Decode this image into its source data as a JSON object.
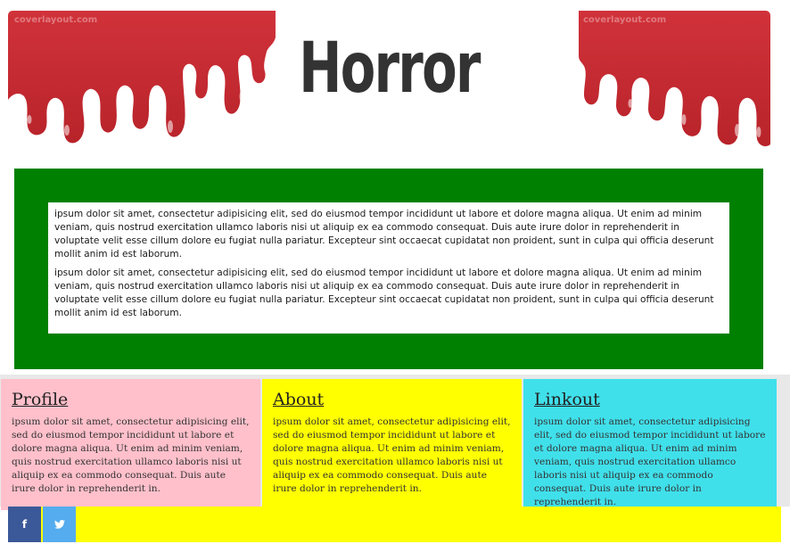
{
  "header": {
    "title": "Horror",
    "watermark": "coverlayout.com",
    "blood_color": "#c62a31"
  },
  "main": {
    "background": "#008000",
    "paragraphs": [
      "ipsum dolor sit amet, consectetur adipisicing elit, sed do eiusmod tempor incididunt ut labore et dolore magna aliqua. Ut enim ad minim veniam, quis nostrud exercitation ullamco laboris nisi ut aliquip ex ea commodo consequat. Duis aute irure dolor in reprehenderit in voluptate velit esse cillum dolore eu fugiat nulla pariatur. Excepteur sint occaecat cupidatat non proident, sunt in culpa qui officia deserunt mollit anim id est laborum.",
      "ipsum dolor sit amet, consectetur adipisicing elit, sed do eiusmod tempor incididunt ut labore et dolore magna aliqua. Ut enim ad minim veniam, quis nostrud exercitation ullamco laboris nisi ut aliquip ex ea commodo consequat. Duis aute irure dolor in reprehenderit in voluptate velit esse cillum dolore eu fugiat nulla pariatur. Excepteur sint occaecat cupidatat non proident, sunt in culpa qui officia deserunt mollit anim id est laborum."
    ]
  },
  "columns": [
    {
      "heading": "Profile",
      "text": "ipsum dolor sit amet, consectetur adipisicing elit, sed do eiusmod tempor incididunt ut labore et dolore magna aliqua. Ut enim ad minim veniam, quis nostrud exercitation ullamco laboris nisi ut aliquip ex ea commodo consequat. Duis aute irure dolor in reprehenderit in.",
      "background": "#ffc0cb"
    },
    {
      "heading": "About",
      "text": "ipsum dolor sit amet, consectetur adipisicing elit, sed do eiusmod tempor incididunt ut labore et dolore magna aliqua. Ut enim ad minim veniam, quis nostrud exercitation ullamco laboris nisi ut aliquip ex ea commodo consequat. Duis aute irure dolor in reprehenderit in.",
      "background": "#ffff00"
    },
    {
      "heading": "Linkout",
      "text": "ipsum dolor sit amet, consectetur adipisicing elit, sed do eiusmod tempor incididunt ut labore et dolore magna aliqua. Ut enim ad minim veniam, quis nostrud exercitation ullamco laboris nisi ut aliquip ex ea commodo consequat. Duis aute irure dolor in reprehenderit in.",
      "background": "#40e0eb"
    }
  ],
  "footer": {
    "background": "#ffff00",
    "social": [
      {
        "icon": "facebook-icon",
        "glyph": "f",
        "color": "#3b5998"
      },
      {
        "icon": "twitter-icon",
        "glyph": "🐦",
        "color": "#55acee"
      }
    ]
  }
}
